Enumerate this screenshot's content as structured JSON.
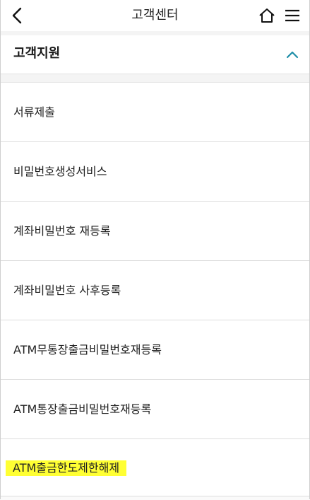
{
  "header": {
    "title": "고객센터"
  },
  "section": {
    "title": "고객지원",
    "accent_color": "#1e8ea8"
  },
  "items": [
    {
      "label": "서류제출"
    },
    {
      "label": "비밀번호생성서비스"
    },
    {
      "label": "계좌비밀번호 재등록"
    },
    {
      "label": "계좌비밀번호 사후등록"
    },
    {
      "label": "ATM무통장출금비밀번호재등록"
    },
    {
      "label": "ATM통장출금비밀번호재등록"
    },
    {
      "label": "ATM출금한도제한해제",
      "highlight": true
    }
  ],
  "highlight_color": "#ffff33"
}
